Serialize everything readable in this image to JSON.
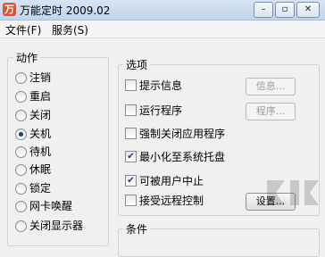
{
  "window": {
    "app_icon_text": "万",
    "title": "万能定时 2009.02",
    "controls": {
      "minimize": "–",
      "restore": "▫",
      "close": "✕"
    }
  },
  "menu": [
    "文件(F)",
    "服务(S)"
  ],
  "actions": {
    "label": "动作",
    "items": [
      {
        "label": "注销",
        "checked": false
      },
      {
        "label": "重启",
        "checked": false
      },
      {
        "label": "关闭",
        "checked": false
      },
      {
        "label": "关机",
        "checked": true
      },
      {
        "label": "待机",
        "checked": false
      },
      {
        "label": "休眠",
        "checked": false
      },
      {
        "label": "锁定",
        "checked": false
      },
      {
        "label": "网卡唤醒",
        "checked": false
      },
      {
        "label": "关闭显示器",
        "checked": false
      }
    ]
  },
  "options": {
    "label": "选项",
    "items": [
      {
        "label": "提示信息",
        "checked": false
      },
      {
        "label": "运行程序",
        "checked": false
      },
      {
        "label": "强制关闭应用程序",
        "checked": false
      },
      {
        "label": "最小化至系统托盘",
        "checked": true
      },
      {
        "label": "可被用户中止",
        "checked": true
      },
      {
        "label": "接受远程控制",
        "checked": false
      }
    ],
    "buttons": {
      "info": "信息...",
      "program": "程序...",
      "settings": "设置..."
    }
  },
  "conditions": {
    "label": "条件"
  }
}
